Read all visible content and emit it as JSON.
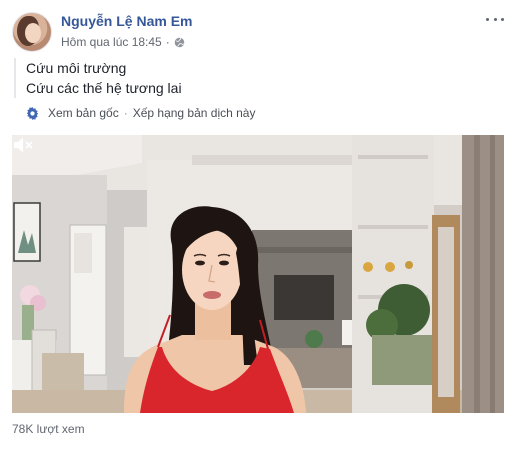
{
  "post": {
    "author": "Nguyễn Lệ Nam Em",
    "timestamp": "Hôm qua lúc 18:45",
    "separator": "·",
    "privacy_icon": "globe-icon",
    "message_lines": [
      "Cứu môi trường",
      "Cứu các thế hệ tương lai"
    ],
    "translation": {
      "see_original": "Xem bản gốc",
      "dot": "·",
      "rate_translation": "Xếp hạng bản dịch này",
      "icon": "gear-icon"
    },
    "video": {
      "mute_icon": "speaker-muted-icon"
    },
    "views": "78K lượt xem"
  },
  "colors": {
    "author_link": "#365899",
    "secondary_text": "#616770",
    "dress": "#d9262d"
  }
}
